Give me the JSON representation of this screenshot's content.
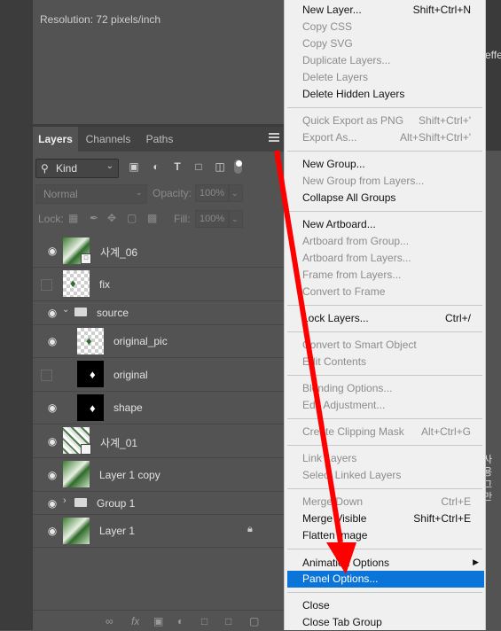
{
  "properties": {
    "resolution": "Resolution: 72 pixels/inch"
  },
  "right_strip": {
    "top_text": "effe",
    "bottom_text_1": "사용",
    "bottom_text_2": "그만"
  },
  "tabs": [
    {
      "label": "Layers",
      "active": true
    },
    {
      "label": "Channels",
      "active": false
    },
    {
      "label": "Paths",
      "active": false
    }
  ],
  "filter": {
    "kind_label": "Kind"
  },
  "blend": {
    "mode": "Normal",
    "opacity_label": "Opacity:",
    "opacity_value": "100%",
    "lock_label": "Lock:",
    "fill_label": "Fill:",
    "fill_value": "100%"
  },
  "layers": [
    {
      "name": "사계_06",
      "visible": true
    },
    {
      "name": "fix",
      "visible": false
    },
    {
      "name": "source",
      "visible": true,
      "type": "group",
      "expanded": true
    },
    {
      "name": "original_pic",
      "visible": true,
      "indent": true
    },
    {
      "name": "original",
      "visible": false,
      "indent": true
    },
    {
      "name": "shape",
      "visible": true,
      "indent": true
    },
    {
      "name": "사계_01",
      "visible": true
    },
    {
      "name": "Layer 1 copy",
      "visible": true
    },
    {
      "name": "Group 1",
      "visible": true,
      "type": "group",
      "expanded": false
    },
    {
      "name": "Layer 1",
      "visible": true,
      "locked": true
    }
  ],
  "menu": {
    "items": [
      {
        "label": "New Layer...",
        "shortcut": "Shift+Ctrl+N",
        "enabled": true
      },
      {
        "label": "Copy CSS",
        "enabled": false
      },
      {
        "label": "Copy SVG",
        "enabled": false
      },
      {
        "label": "Duplicate Layers...",
        "enabled": false
      },
      {
        "label": "Delete Layers",
        "enabled": false
      },
      {
        "label": "Delete Hidden Layers",
        "enabled": true
      },
      {
        "label": "Quick Export as PNG",
        "shortcut": "Shift+Ctrl+'",
        "enabled": false
      },
      {
        "label": "Export As...",
        "shortcut": "Alt+Shift+Ctrl+'",
        "enabled": false
      },
      {
        "label": "New Group...",
        "enabled": true
      },
      {
        "label": "New Group from Layers...",
        "enabled": false
      },
      {
        "label": "Collapse All Groups",
        "enabled": true
      },
      {
        "label": "New Artboard...",
        "enabled": true
      },
      {
        "label": "Artboard from Group...",
        "enabled": false
      },
      {
        "label": "Artboard from Layers...",
        "enabled": false
      },
      {
        "label": "Frame from Layers...",
        "enabled": false
      },
      {
        "label": "Convert to Frame",
        "enabled": false
      },
      {
        "label": "Lock Layers...",
        "shortcut": "Ctrl+/",
        "enabled": true
      },
      {
        "label": "Convert to Smart Object",
        "enabled": false
      },
      {
        "label": "Edit Contents",
        "enabled": false
      },
      {
        "label": "Blending Options...",
        "enabled": false
      },
      {
        "label": "Edit Adjustment...",
        "enabled": false
      },
      {
        "label": "Create Clipping Mask",
        "shortcut": "Alt+Ctrl+G",
        "enabled": false
      },
      {
        "label": "Link Layers",
        "enabled": false
      },
      {
        "label": "Select Linked Layers",
        "enabled": false
      },
      {
        "label": "Merge Down",
        "shortcut": "Ctrl+E",
        "enabled": false
      },
      {
        "label": "Merge Visible",
        "shortcut": "Shift+Ctrl+E",
        "enabled": true
      },
      {
        "label": "Flatten Image",
        "enabled": true
      },
      {
        "label": "Animation Options",
        "enabled": true,
        "submenu": true
      },
      {
        "label": "Panel Options...",
        "enabled": true,
        "highlighted": true
      },
      {
        "label": "Close",
        "enabled": true
      },
      {
        "label": "Close Tab Group",
        "enabled": true
      }
    ]
  },
  "colors": {
    "highlight": "#0b74d9",
    "arrow": "#ff0000",
    "panel": "#535353"
  }
}
